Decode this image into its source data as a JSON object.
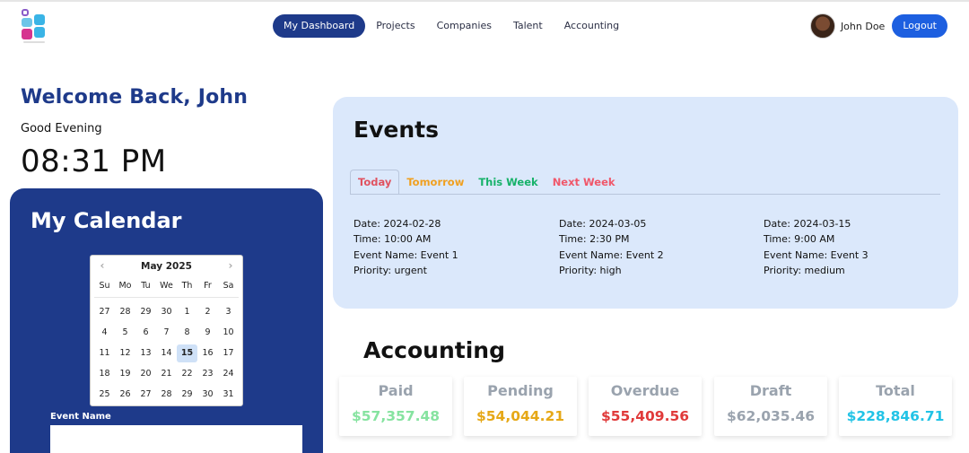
{
  "nav": {
    "items": [
      {
        "label": "My Dashboard",
        "active": true
      },
      {
        "label": "Projects",
        "active": false
      },
      {
        "label": "Companies",
        "active": false
      },
      {
        "label": "Talent",
        "active": false
      },
      {
        "label": "Accounting",
        "active": false
      }
    ]
  },
  "user": {
    "name": "John Doe",
    "logout_label": "Logout",
    "avatar_icon": "user-avatar"
  },
  "welcome": {
    "title": "Welcome Back, John",
    "greeting": "Good Evening",
    "time": "08:31 PM"
  },
  "calendar": {
    "title": "My Calendar",
    "month_label": "May 2025",
    "weekdays": [
      "Su",
      "Mo",
      "Tu",
      "We",
      "Th",
      "Fr",
      "Sa"
    ],
    "days": [
      "27",
      "28",
      "29",
      "30",
      "1",
      "2",
      "3",
      "4",
      "5",
      "6",
      "7",
      "8",
      "9",
      "10",
      "11",
      "12",
      "13",
      "14",
      "15",
      "16",
      "17",
      "18",
      "19",
      "20",
      "21",
      "22",
      "23",
      "24",
      "25",
      "26",
      "27",
      "28",
      "29",
      "30",
      "31"
    ],
    "selected_day": "15",
    "event_name_label": "Event Name",
    "event_name_value": ""
  },
  "events": {
    "title": "Events",
    "tabs": [
      {
        "label": "Today",
        "color": "#e05260",
        "active": true
      },
      {
        "label": "Tomorrow",
        "color": "#f0a020",
        "active": false
      },
      {
        "label": "This Week",
        "color": "#17b26a",
        "active": false
      },
      {
        "label": "Next Week",
        "color": "#f0576a",
        "active": false
      }
    ],
    "items": [
      {
        "date": "Date: 2024-02-28",
        "time": "Time: 10:00 AM",
        "name": "Event Name: Event 1",
        "priority": "Priority: urgent"
      },
      {
        "date": "Date: 2024-03-05",
        "time": "Time: 2:30 PM",
        "name": "Event Name: Event 2",
        "priority": "Priority: high"
      },
      {
        "date": "Date: 2024-03-15",
        "time": "Time: 9:00 AM",
        "name": "Event Name: Event 3",
        "priority": "Priority: medium"
      }
    ]
  },
  "accounting": {
    "title": "Accounting",
    "cards": [
      {
        "label": "Paid",
        "value": "$57,357.48",
        "color": "#86e3a0"
      },
      {
        "label": "Pending",
        "value": "$54,044.21",
        "color": "#e6a817"
      },
      {
        "label": "Overdue",
        "value": "$55,409.56",
        "color": "#e03a3a"
      },
      {
        "label": "Draft",
        "value": "$62,035.46",
        "color": "#9aa3ae"
      },
      {
        "label": "Total",
        "value": "$228,846.71",
        "color": "#22c3e6"
      }
    ]
  },
  "colors": {
    "brand": "#1e3a8a",
    "events_bg": "#dbe8fb",
    "logout": "#1d5fe0"
  }
}
